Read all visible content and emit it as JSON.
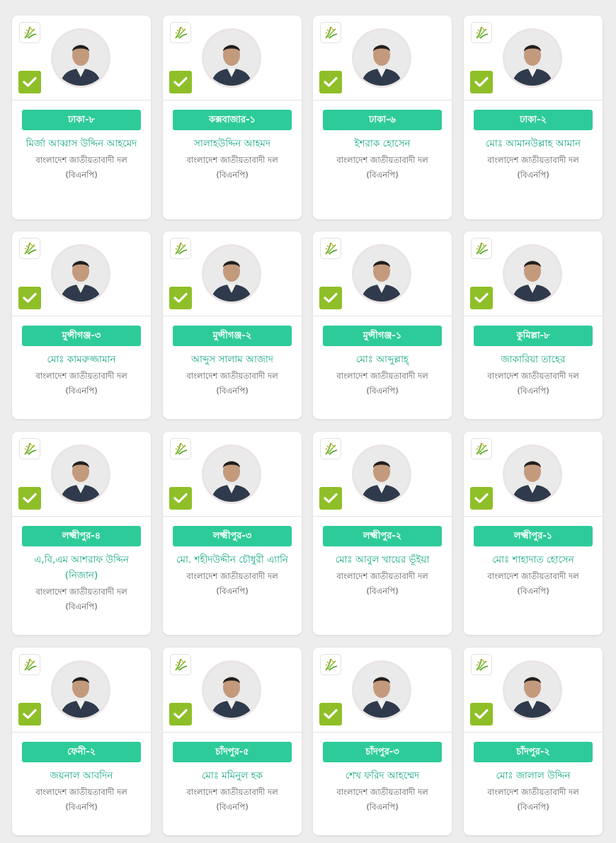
{
  "theme": {
    "badge_color": "#2ecb9a",
    "name_color": "#17a883",
    "check_color": "#8fbf28",
    "logo_icon": "paddy-sheaf-icon",
    "check_icon": "checkmark-icon"
  },
  "candidates": [
    {
      "constituency": "ঢাকা-৮",
      "name": "মির্জা আব্বাস উদ্দিন আহমেদ",
      "party": "বাংলাদেশ জাতীয়তাবাদী দল",
      "party_abbr": "(বিএনপি)"
    },
    {
      "constituency": "কক্সবাজার-১",
      "name": "সালাহউদ্দিন আহমদ",
      "party": "বাংলাদেশ জাতীয়তাবাদী দল",
      "party_abbr": "(বিএনপি)"
    },
    {
      "constituency": "ঢাকা-৬",
      "name": "ইশরাক হোসেন",
      "party": "বাংলাদেশ জাতীয়তাবাদী দল",
      "party_abbr": "(বিএনপি)"
    },
    {
      "constituency": "ঢাকা-২",
      "name": "মোঃ আমানউল্লাহ আমান",
      "party": "বাংলাদেশ জাতীয়তাবাদী দল",
      "party_abbr": "(বিএনপি)"
    },
    {
      "constituency": "মুন্সীগঞ্জ-৩",
      "name": "মোঃ কামরুজ্জামান",
      "party": "বাংলাদেশ জাতীয়তাবাদী দল",
      "party_abbr": "(বিএনপি)"
    },
    {
      "constituency": "মুন্সীগঞ্জ-২",
      "name": "আব্দুস সালাম আজাদ",
      "party": "বাংলাদেশ জাতীয়তাবাদী দল",
      "party_abbr": "(বিএনপি)"
    },
    {
      "constituency": "মুন্সীগঞ্জ-১",
      "name": "মোঃ আব্দুল্লাহ্",
      "party": "বাংলাদেশ জাতীয়তাবাদী দল",
      "party_abbr": "(বিএনপি)"
    },
    {
      "constituency": "কুমিল্লা-৮",
      "name": "জাকারিয়া তাহের",
      "party": "বাংলাদেশ জাতীয়তাবাদী দল",
      "party_abbr": "(বিএনপি)"
    },
    {
      "constituency": "লক্ষ্মীপুর-৪",
      "name": "এ,বি,এম আশরাফ উদ্দিন (নিজান)",
      "party": "বাংলাদেশ জাতীয়তাবাদী দল",
      "party_abbr": "(বিএনপি)"
    },
    {
      "constituency": "লক্ষ্মীপুর-৩",
      "name": "মো. শহীদউদ্দীন চৌধুরী এ্যানি",
      "party": "বাংলাদেশ জাতীয়তাবাদী দল",
      "party_abbr": "(বিএনপি)"
    },
    {
      "constituency": "লক্ষ্মীপুর-২",
      "name": "মোঃ আবুল খায়ের ভূঁইয়া",
      "party": "বাংলাদেশ জাতীয়তাবাদী দল",
      "party_abbr": "(বিএনপি)"
    },
    {
      "constituency": "লক্ষ্মীপুর-১",
      "name": "মোঃ শাহাদাত হোসেন",
      "party": "বাংলাদেশ জাতীয়তাবাদী দল",
      "party_abbr": "(বিএনপি)"
    },
    {
      "constituency": "ফেনী-২",
      "name": "জয়নাল আবদিন",
      "party": "বাংলাদেশ জাতীয়তাবাদী দল",
      "party_abbr": "(বিএনপি)"
    },
    {
      "constituency": "চাঁদপুর-৫",
      "name": "মোঃ মমিনুল হক",
      "party": "বাংলাদেশ জাতীয়তাবাদী দল",
      "party_abbr": "(বিএনপি)"
    },
    {
      "constituency": "চাঁদপুর-৩",
      "name": "শেখ ফরিদ আহম্মেদ",
      "party": "বাংলাদেশ জাতীয়তাবাদী দল",
      "party_abbr": "(বিএনপি)"
    },
    {
      "constituency": "চাঁদপুর-২",
      "name": "মোঃ জালাল উদ্দিন",
      "party": "বাংলাদেশ জাতীয়তাবাদী দল",
      "party_abbr": "(বিএনপি)"
    }
  ]
}
